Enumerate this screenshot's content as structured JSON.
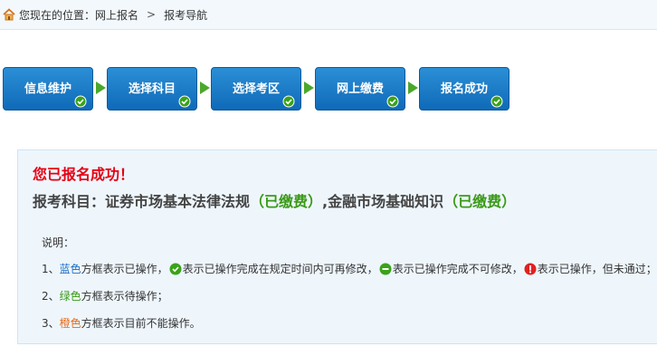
{
  "breadcrumb": {
    "location_label": "您现在的位置：网上报名",
    "separator": ">",
    "current": "报考导航"
  },
  "steps": [
    {
      "label": "信息维护",
      "status": "completed-modifiable"
    },
    {
      "label": "选择科目",
      "status": "completed-modifiable"
    },
    {
      "label": "选择考区",
      "status": "completed-modifiable"
    },
    {
      "label": "网上缴费",
      "status": "completed-modifiable"
    },
    {
      "label": "报名成功",
      "status": "completed-modifiable"
    }
  ],
  "result": {
    "success_title": "您已报名成功！",
    "subject_prefix": "报考科目：证券市场基本法律法规",
    "subject1_status": "（已缴费）",
    "subject_separator": ",金融市场基础知识",
    "subject2_status": "（已缴费）"
  },
  "notes": {
    "label": "说明：",
    "row1": {
      "index": "1、",
      "color_word": "蓝色",
      "text_a": "方框表示已操作，",
      "text_b": "表示已操作完成在规定时间内可再修改，",
      "text_c": "表示已操作完成不可修改，",
      "text_d": "表示已操作，但未通过；"
    },
    "row2": {
      "index": "2、",
      "color_word": "绿色",
      "text": "方框表示待操作；"
    },
    "row3": {
      "index": "3、",
      "color_word": "橙色",
      "text": "方框表示目前不能操作。"
    }
  },
  "icons": {
    "home": "home-icon",
    "step_check": "green-check-icon",
    "step_arrow": "green-arrow-right-icon",
    "modifiable": "green-check-icon",
    "locked": "green-minus-icon",
    "failed": "red-exclamation-icon"
  },
  "colors": {
    "step_blue": "#1a7ac8",
    "success_red": "#e60012",
    "paid_green": "#3a9a16",
    "note_blue": "#1a6fc4",
    "note_green": "#3a9a16",
    "note_orange": "#e56a1a"
  }
}
